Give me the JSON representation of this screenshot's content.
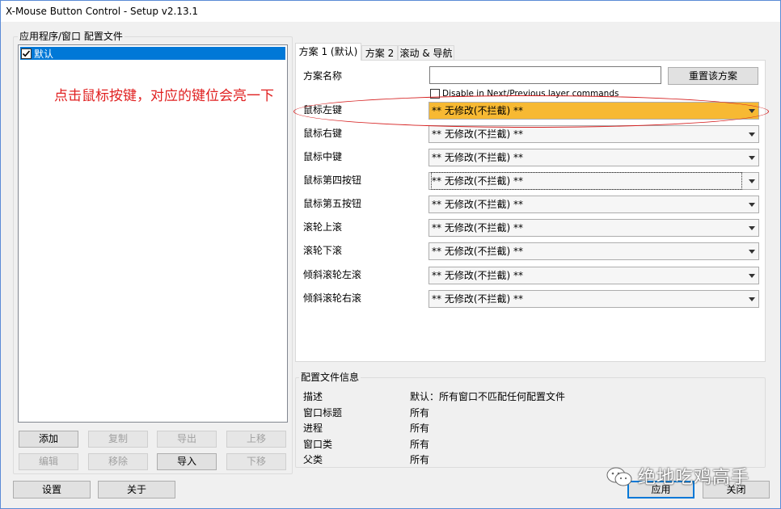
{
  "window": {
    "title": "X-Mouse Button Control - Setup v2.13.1"
  },
  "profiles": {
    "group_label": "应用程序/窗口 配置文件",
    "items": [
      {
        "label": "默认",
        "checked": true
      }
    ]
  },
  "left_buttons": {
    "add": "添加",
    "copy": "复制",
    "export": "导出",
    "move_up": "上移",
    "edit": "编辑",
    "remove": "移除",
    "import": "导入",
    "move_down": "下移"
  },
  "annotation": "点击鼠标按键，对应的键位会亮一下",
  "tabs": [
    {
      "label": "方案 1 (默认)",
      "active": true
    },
    {
      "label": "方案 2",
      "active": false
    },
    {
      "label": "滚动 & 导航",
      "active": false
    }
  ],
  "scheme": {
    "name_label": "方案名称",
    "name_value": "",
    "reset_button": "重置该方案",
    "disable_layer_checkbox": "Disable in Next/Previous layer commands",
    "rows": [
      {
        "label": "鼠标左键",
        "value": "** 无修改(不拦截) **",
        "highlighted": true
      },
      {
        "label": "鼠标右键",
        "value": "** 无修改(不拦截) **"
      },
      {
        "label": "鼠标中键",
        "value": "** 无修改(不拦截) **"
      },
      {
        "label": "鼠标第四按钮",
        "value": "** 无修改(不拦截) **"
      },
      {
        "label": "鼠标第五按钮",
        "value": "** 无修改(不拦截) **"
      },
      {
        "label": "滚轮上滚",
        "value": "** 无修改(不拦截) **"
      },
      {
        "label": "滚轮下滚",
        "value": "** 无修改(不拦截) **"
      },
      {
        "label": "倾斜滚轮左滚",
        "value": "** 无修改(不拦截) **"
      },
      {
        "label": "倾斜滚轮右滚",
        "value": "** 无修改(不拦截) **"
      }
    ]
  },
  "profile_info": {
    "group_label": "配置文件信息",
    "rows": [
      {
        "key": "描述",
        "value": "默认：所有窗口不匹配任何配置文件"
      },
      {
        "key": "窗口标题",
        "value": "所有"
      },
      {
        "key": "进程",
        "value": "所有"
      },
      {
        "key": "窗口类",
        "value": "所有"
      },
      {
        "key": "父类",
        "value": "所有"
      }
    ]
  },
  "bottom_buttons": {
    "settings": "设置",
    "about": "关于",
    "apply": "应用",
    "close": "关闭"
  },
  "watermark": "绝地吃鸡高手",
  "colors": {
    "highlight": "#f7b933",
    "selection": "#0078d7",
    "annotation": "#e02020"
  }
}
